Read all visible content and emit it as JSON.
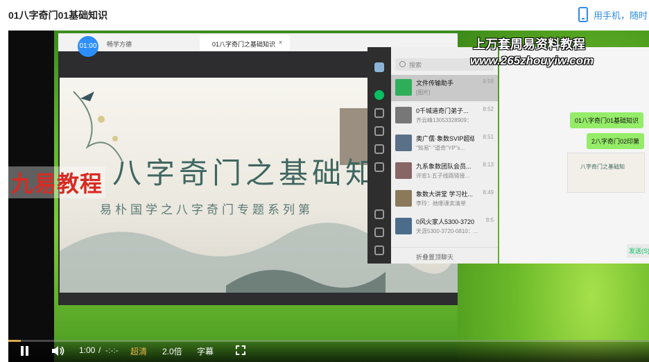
{
  "header": {
    "title": "01八字奇门01基础知识",
    "mobile_hint": "用手机，随时"
  },
  "browser": {
    "timer": "01:00",
    "tab_left": "畅学方德",
    "tab_active": "01八字奇门之基础知识",
    "tab_close": "×"
  },
  "slide": {
    "title": "八字奇门之基础知",
    "subtitle": "易朴国学之八字奇门专题系列第"
  },
  "brand_watermark": "九易教程",
  "site_watermark": {
    "line1": "上万套周易资料教程",
    "line2": "www.265zhouyiw.com"
  },
  "chat": {
    "search_placeholder": "搜索",
    "items": [
      {
        "name": "文件传输助手",
        "preview": "[图片]",
        "time": "8:58"
      },
      {
        "name": "0千城道奇门弟子...",
        "preview": "齐云峰13053328909：",
        "time": "8:52"
      },
      {
        "name": "奥广儒·象数SVIP超级...",
        "preview": "\"知易\"·\"道奇\"YP\"s...",
        "time": "8:51"
      },
      {
        "name": "九系象数团队会员...",
        "preview": "许宏1:五子线路链接...",
        "time": "8:13"
      },
      {
        "name": "象数大讲堂 学习社...",
        "preview": "李玲：她哪课卖清单",
        "time": "8:49"
      },
      {
        "name": "0风火家人5300-3720...",
        "preview": "天涯5300-3720-0810：...",
        "time": "8:5"
      }
    ],
    "footer": "折叠置顶聊天",
    "bubbles": [
      "01八字奇门01基础知识",
      "2八字奇门02印第"
    ],
    "thumb_caption": "八字奇门之基础知",
    "send_label": "发送(S)"
  },
  "controls": {
    "current_time": "1:00",
    "separator": "/",
    "duration": "-:-:-",
    "quality": "超清",
    "speed": "2.0倍",
    "subtitle": "字幕",
    "progress": 0.02
  }
}
